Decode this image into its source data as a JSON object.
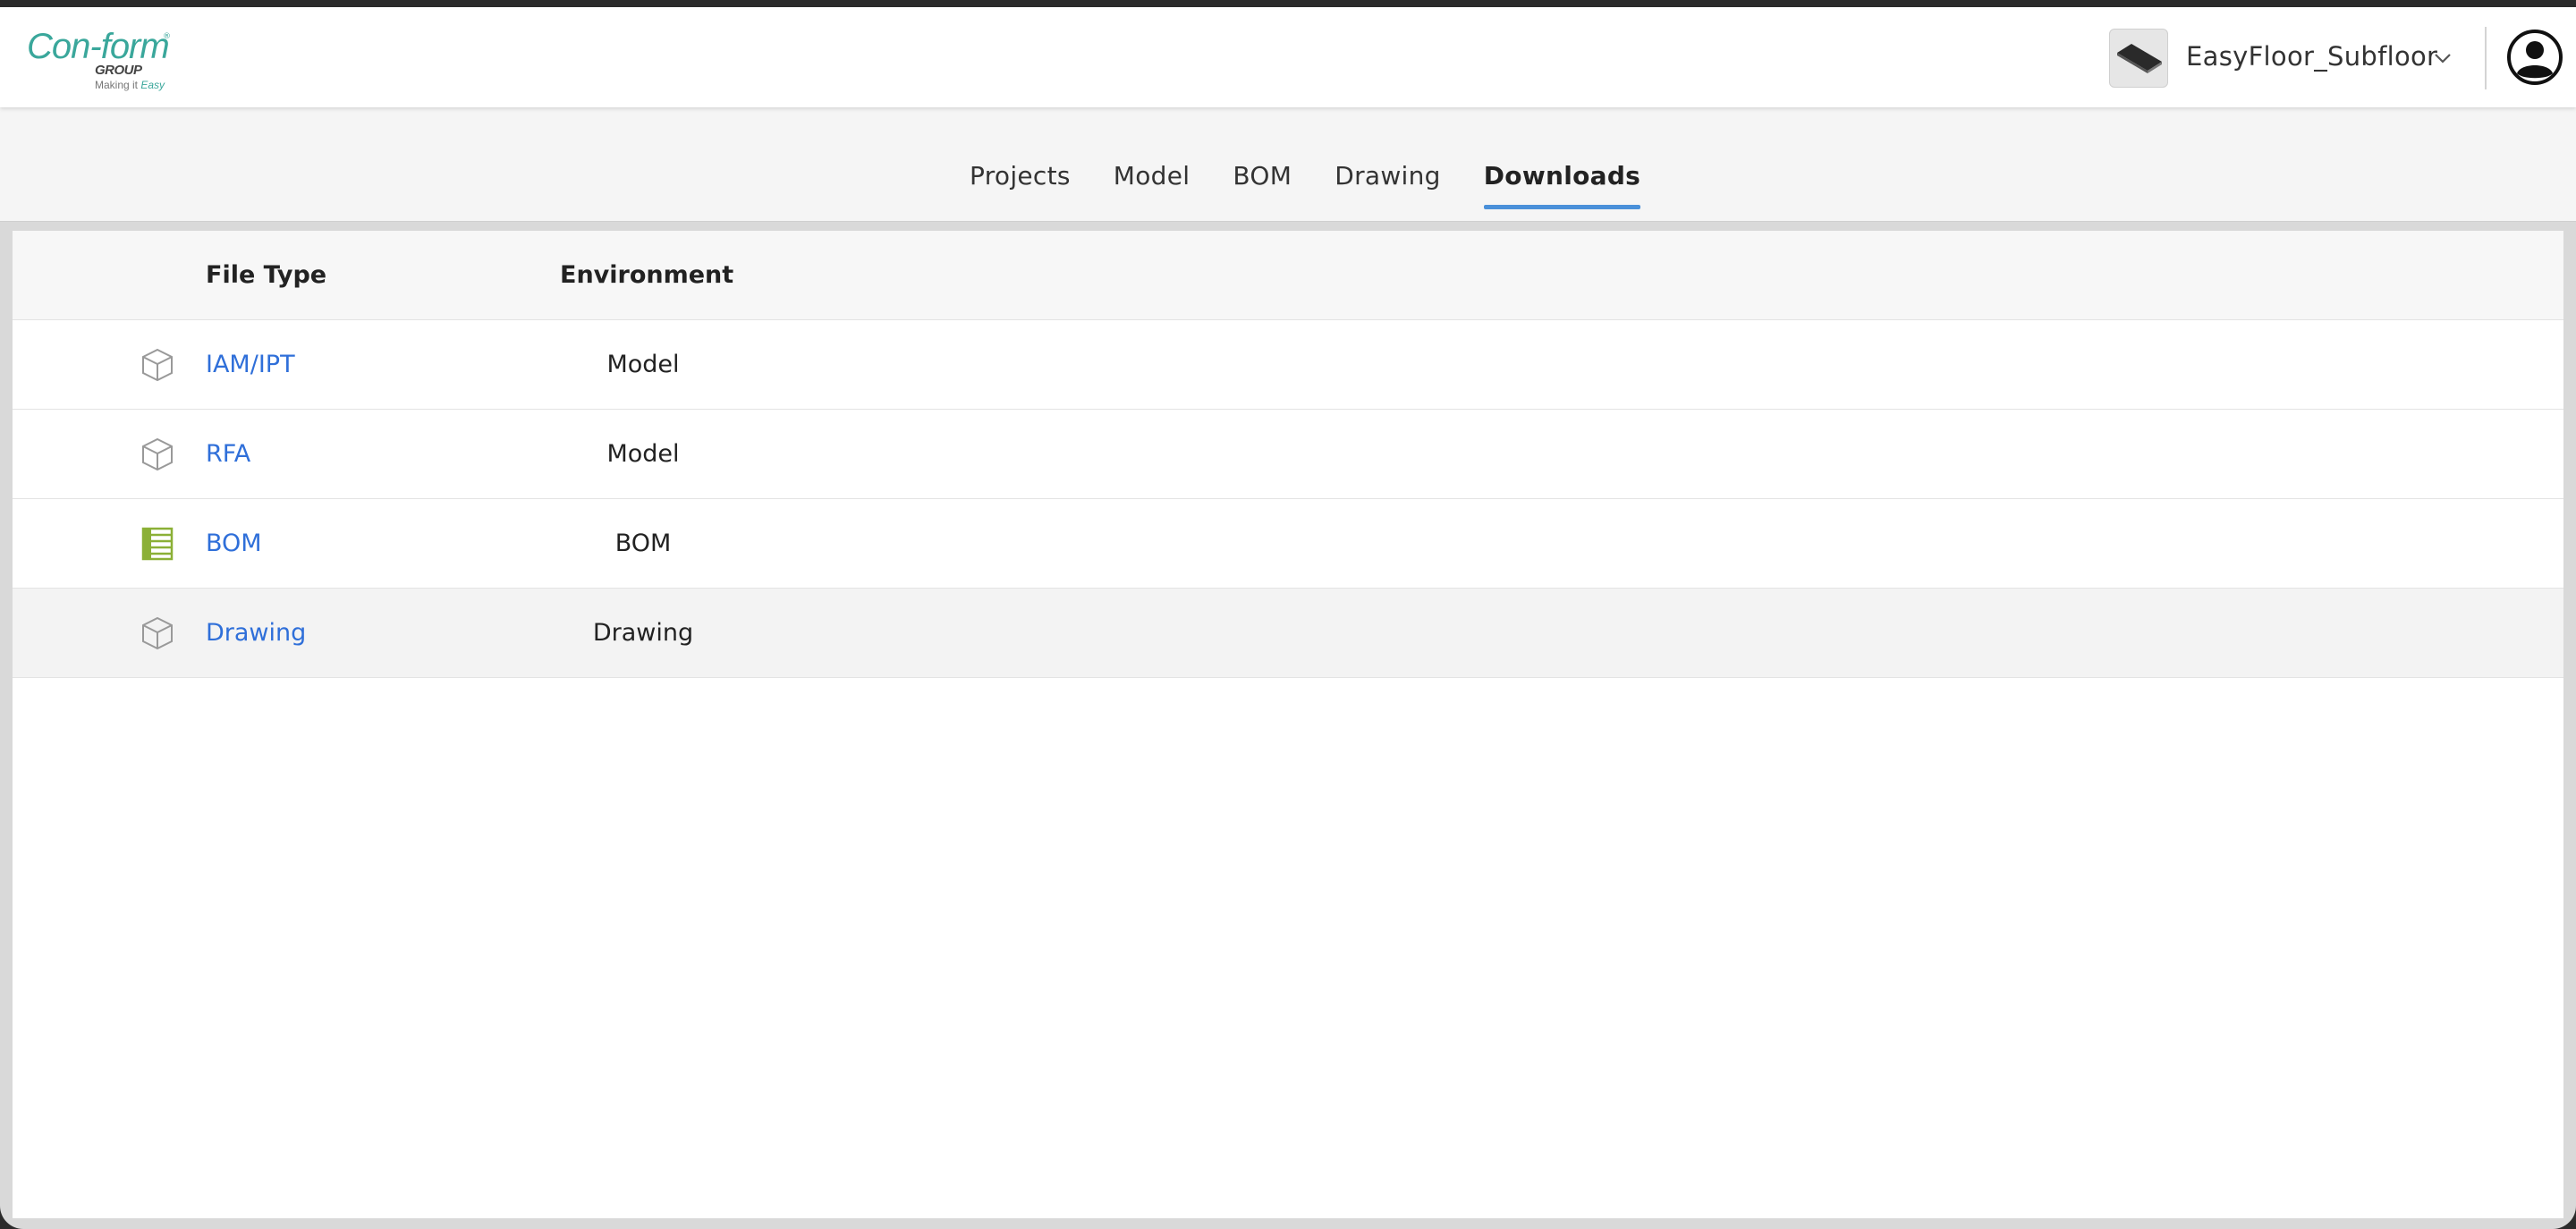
{
  "header": {
    "logo": {
      "line1": "Con-form",
      "reg": "®",
      "line2": "GROUP",
      "tagline_prefix": "Making it ",
      "tagline_em": "Easy"
    },
    "project": {
      "name": "EasyFloor_Subfloor",
      "thumb_icon": "floor-panel-icon"
    },
    "user_icon": "user-avatar-icon"
  },
  "tabs": [
    {
      "label": "Projects",
      "active": false
    },
    {
      "label": "Model",
      "active": false
    },
    {
      "label": "BOM",
      "active": false
    },
    {
      "label": "Drawing",
      "active": false
    },
    {
      "label": "Downloads",
      "active": true
    }
  ],
  "table": {
    "columns": {
      "file_type": "File Type",
      "environment": "Environment"
    },
    "rows": [
      {
        "file_type": "IAM/IPT",
        "environment": "Model",
        "icon": "cube-icon"
      },
      {
        "file_type": "RFA",
        "environment": "Model",
        "icon": "cube-icon"
      },
      {
        "file_type": "BOM",
        "environment": "BOM",
        "icon": "spreadsheet-icon"
      },
      {
        "file_type": "Drawing",
        "environment": "Drawing",
        "icon": "cube-icon"
      }
    ]
  },
  "colors": {
    "accent": "#4a90d9",
    "link": "#2f6fd9",
    "logo_teal": "#3aa79b",
    "bom_green": "#8bb036"
  }
}
